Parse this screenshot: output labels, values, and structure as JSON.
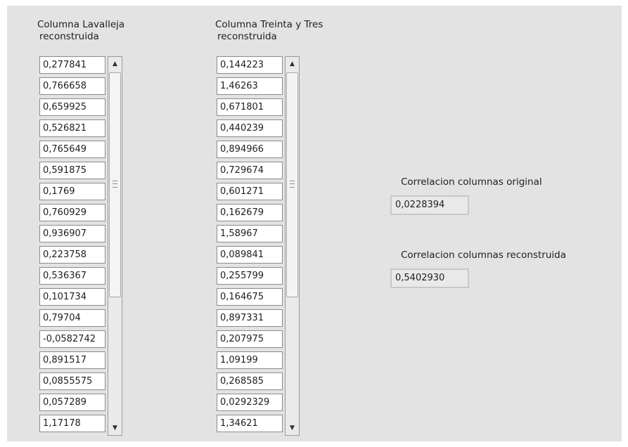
{
  "arrays": [
    {
      "label_line1": "Columna Lavalleja",
      "label_line2": "reconstruida",
      "values": [
        "0,277841",
        "0,766658",
        "0,659925",
        "0,526821",
        "0,765649",
        "0,591875",
        "0,1769",
        "0,760929",
        "0,936907",
        "0,223758",
        "0,536367",
        "0,101734",
        "0,79704",
        "-0,0582742",
        "0,891517",
        "0,0855575",
        "0,057289",
        "1,17178"
      ]
    },
    {
      "label_line1": "Columna Treinta y Tres",
      "label_line2": "reconstruida",
      "values": [
        "0,144223",
        "1,46263",
        "0,671801",
        "0,440239",
        "0,894966",
        "0,729674",
        "0,601271",
        "0,162679",
        "1,58967",
        "0,089841",
        "0,255799",
        "0,164675",
        "0,897331",
        "0,207975",
        "1,09199",
        "0,268585",
        "0,0292329",
        "1,34621"
      ]
    }
  ],
  "correlation_original": {
    "label": "Correlacion columnas original",
    "value": "0,0228394"
  },
  "correlation_reconstructed": {
    "label": "Correlacion columnas reconstruida",
    "value": "0,5402930"
  },
  "icons": {
    "scroll_up": "arrow-up-icon",
    "scroll_down": "arrow-down-icon",
    "grip": "scroll-grip-icon"
  }
}
